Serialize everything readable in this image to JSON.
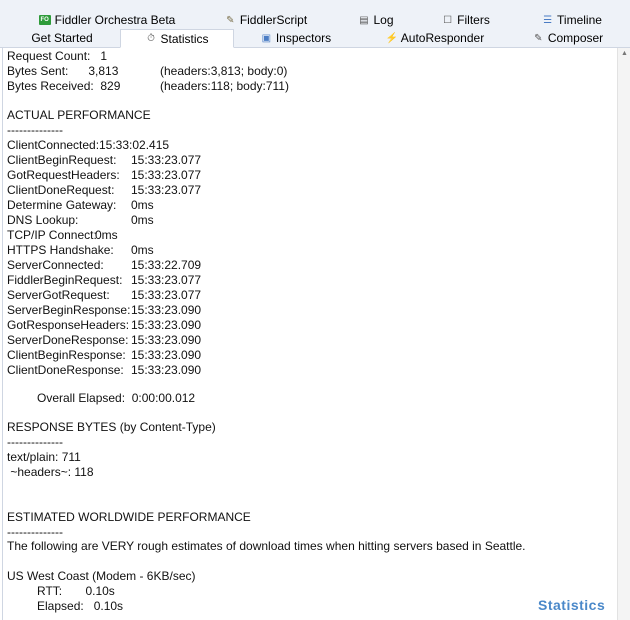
{
  "tabs_row1": [
    {
      "label": "Fiddler Orchestra Beta",
      "icon": "fo-icon",
      "glyph": "FO"
    },
    {
      "label": "FiddlerScript",
      "icon": "script-icon",
      "glyph": "✎"
    },
    {
      "label": "Log",
      "icon": "log-icon",
      "glyph": "▤"
    },
    {
      "label": "Filters",
      "icon": "filters-icon",
      "glyph": "☐"
    },
    {
      "label": "Timeline",
      "icon": "timeline-icon",
      "glyph": "☰"
    }
  ],
  "tabs_row2": [
    {
      "label": "Get Started",
      "icon": "",
      "glyph": ""
    },
    {
      "label": "Statistics",
      "icon": "stopwatch-icon",
      "glyph": "⏱"
    },
    {
      "label": "Inspectors",
      "icon": "inspect-icon",
      "glyph": "▣"
    },
    {
      "label": "AutoResponder",
      "icon": "lightning-icon",
      "glyph": "⚡"
    },
    {
      "label": "Composer",
      "icon": "compose-icon",
      "glyph": "✎"
    }
  ],
  "stats": {
    "request_count": "Request Count:   1",
    "bytes_sent_label": "Bytes Sent:      3,813",
    "bytes_sent_detail": "(headers:3,813; body:0)",
    "bytes_received_label": "Bytes Received:  829",
    "bytes_received_detail": "(headers:118; body:711)",
    "actual_perf_heading": "ACTUAL PERFORMANCE",
    "separator": "--------------",
    "timings": [
      {
        "k": "ClientConnected:",
        "v": "15:33:02.415",
        "inline": true
      },
      {
        "k": "ClientBeginRequest:",
        "v": "15:33:23.077"
      },
      {
        "k": "GotRequestHeaders:",
        "v": "15:33:23.077"
      },
      {
        "k": "ClientDoneRequest:",
        "v": "15:33:23.077"
      },
      {
        "k": "Determine Gateway:",
        "v": "0ms"
      },
      {
        "k": "DNS Lookup:",
        "v": "0ms"
      },
      {
        "k": "TCP/IP Connect:",
        "v": "0ms",
        "inline": true
      },
      {
        "k": "HTTPS Handshake:",
        "v": "0ms"
      },
      {
        "k": "ServerConnected:",
        "v": "15:33:22.709"
      },
      {
        "k": "FiddlerBeginRequest:",
        "v": "15:33:23.077"
      },
      {
        "k": "ServerGotRequest:",
        "v": "15:33:23.077"
      },
      {
        "k": "ServerBeginResponse:",
        "v": "15:33:23.090"
      },
      {
        "k": "GotResponseHeaders:",
        "v": "15:33:23.090"
      },
      {
        "k": "ServerDoneResponse:",
        "v": "15:33:23.090"
      },
      {
        "k": "ClientBeginResponse:",
        "v": "15:33:23.090"
      },
      {
        "k": "ClientDoneResponse:",
        "v": "15:33:23.090"
      }
    ],
    "overall_elapsed": "Overall Elapsed:  0:00:00.012",
    "response_bytes_heading": "RESPONSE BYTES (by Content-Type)",
    "response_bytes_lines": [
      "text/plain: 711",
      " ~headers~: 118"
    ],
    "estimated_heading": "ESTIMATED WORLDWIDE PERFORMANCE",
    "estimated_note": "The following are VERY rough estimates of download times when hitting servers based in Seattle.",
    "region": "US West Coast (Modem - 6KB/sec)",
    "rtt": "RTT:       0.10s",
    "elapsed": "Elapsed:   0.10s"
  },
  "watermark": "Statistics"
}
